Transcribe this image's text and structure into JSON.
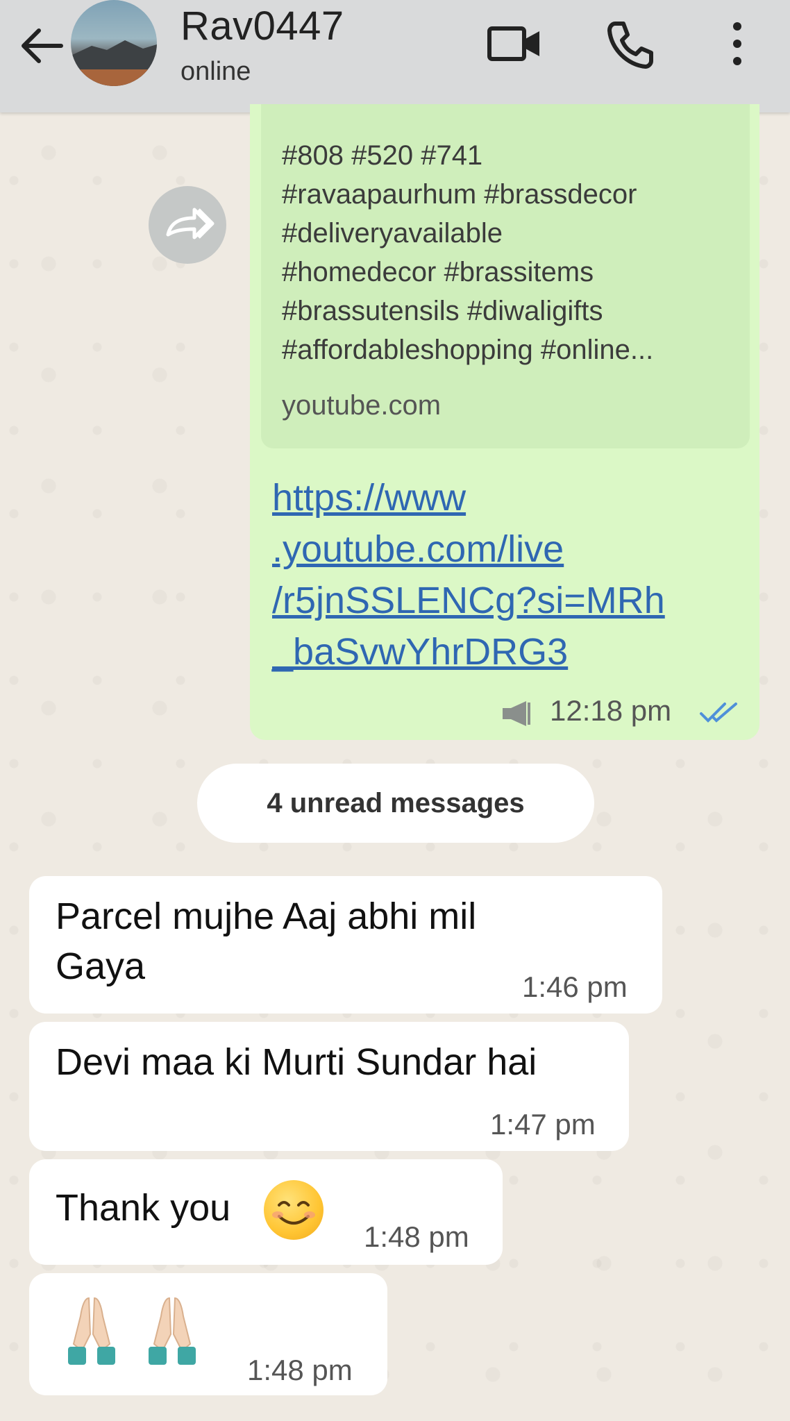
{
  "header": {
    "contact_name": "Rav0447",
    "status": "online",
    "icons": [
      "back-arrow-icon",
      "video-call-icon",
      "phone-call-icon",
      "more-options-icon"
    ]
  },
  "outgoing": {
    "hashtags": "#808 #520 #741\n#ravaapaurhum #brassdecor\n#deliveryavailable\n#homedecor #brassitems\n#brassutensils #diwaligifts\n#affordableshopping #online...",
    "preview_domain": "youtube.com",
    "link": "https://www\n.youtube.com/live\n/r5jnSSLENCg?si=MRh\n_baSvwYhrDRG3",
    "time": "12:18 pm"
  },
  "unread_label": "4 unread messages",
  "incoming": [
    {
      "text": "Parcel mujhe Aaj abhi mil\nGaya",
      "time": "1:46 pm"
    },
    {
      "text": "Devi maa ki Murti Sundar hai",
      "time": "1:47 pm"
    },
    {
      "text": "Thank you",
      "time": "1:48 pm"
    },
    {
      "text": "",
      "time": "1:48 pm"
    }
  ],
  "colors": {
    "header_bg": "#d9dadb",
    "chat_bg": "#efeae2",
    "outgoing_bubble": "#dbf8c6",
    "link": "#2f67b2",
    "read_ticks": "#4f90d9"
  }
}
